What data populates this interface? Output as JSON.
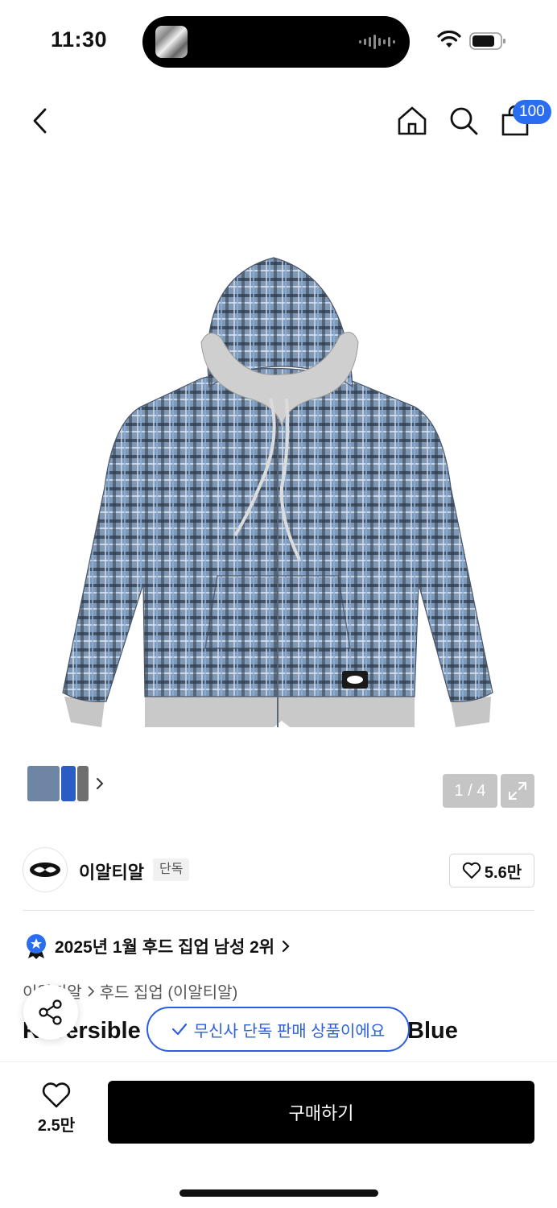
{
  "status_bar": {
    "time": "11:30"
  },
  "nav": {
    "cart_count": "100"
  },
  "gallery": {
    "counter": "1 / 4"
  },
  "brand": {
    "name": "이알티알",
    "tag": "단독",
    "likes": "5.6만"
  },
  "ranking": {
    "text": "2025년 1월 후드 집업 남성 2위"
  },
  "breadcrumb": {
    "parent": "이알티알",
    "category": "후드 집업 (이알티알)"
  },
  "product": {
    "title_start": "Reversible",
    "title_end": "Blue"
  },
  "toast": {
    "text": "무신사 단독 판매 상품이에요"
  },
  "bottom_bar": {
    "wish_count": "2.5만",
    "buy_label": "구매하기"
  },
  "colors": {
    "accent": "#2b5fe0",
    "badge": "#2b6df0",
    "buy_button": "#000000"
  }
}
